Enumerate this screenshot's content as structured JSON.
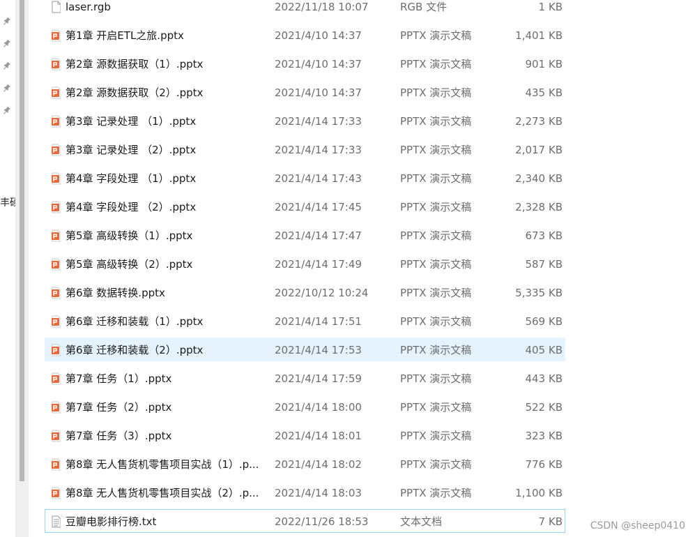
{
  "nav_pane": {
    "visible_text": "丰硕"
  },
  "files": [
    {
      "name": "laser.rgb",
      "date": "2022/11/18 10:07",
      "type": "RGB 文件",
      "size": "1 KB",
      "icon": "generic-file-icon"
    },
    {
      "name": "第1章 开启ETL之旅.pptx",
      "date": "2021/4/10 14:37",
      "type": "PPTX 演示文稿",
      "size": "1,401 KB",
      "icon": "pptx-file-icon"
    },
    {
      "name": "第2章 源数据获取（1）.pptx",
      "date": "2021/4/10 14:37",
      "type": "PPTX 演示文稿",
      "size": "901 KB",
      "icon": "pptx-file-icon"
    },
    {
      "name": "第2章 源数据获取（2）.pptx",
      "date": "2021/4/10 14:37",
      "type": "PPTX 演示文稿",
      "size": "435 KB",
      "icon": "pptx-file-icon"
    },
    {
      "name": "第3章 记录处理 （1）.pptx",
      "date": "2021/4/14 17:33",
      "type": "PPTX 演示文稿",
      "size": "2,273 KB",
      "icon": "pptx-file-icon"
    },
    {
      "name": "第3章 记录处理 （2）.pptx",
      "date": "2021/4/14 17:33",
      "type": "PPTX 演示文稿",
      "size": "2,017 KB",
      "icon": "pptx-file-icon"
    },
    {
      "name": "第4章 字段处理 （1）.pptx",
      "date": "2021/4/14 17:43",
      "type": "PPTX 演示文稿",
      "size": "2,340 KB",
      "icon": "pptx-file-icon"
    },
    {
      "name": "第4章 字段处理 （2）.pptx",
      "date": "2021/4/14 17:45",
      "type": "PPTX 演示文稿",
      "size": "2,328 KB",
      "icon": "pptx-file-icon"
    },
    {
      "name": "第5章 高级转换（1）.pptx",
      "date": "2021/4/14 17:47",
      "type": "PPTX 演示文稿",
      "size": "673 KB",
      "icon": "pptx-file-icon"
    },
    {
      "name": "第5章 高级转换（2）.pptx",
      "date": "2021/4/14 17:49",
      "type": "PPTX 演示文稿",
      "size": "587 KB",
      "icon": "pptx-file-icon"
    },
    {
      "name": "第6章 数据转换.pptx",
      "date": "2022/10/12 10:24",
      "type": "PPTX 演示文稿",
      "size": "5,335 KB",
      "icon": "pptx-file-icon"
    },
    {
      "name": "第6章 迁移和装载（1）.pptx",
      "date": "2021/4/14 17:51",
      "type": "PPTX 演示文稿",
      "size": "569 KB",
      "icon": "pptx-file-icon"
    },
    {
      "name": "第6章 迁移和装载（2）.pptx",
      "date": "2021/4/14 17:53",
      "type": "PPTX 演示文稿",
      "size": "405 KB",
      "icon": "pptx-file-icon",
      "selected": true
    },
    {
      "name": "第7章 任务（1）.pptx",
      "date": "2021/4/14 17:59",
      "type": "PPTX 演示文稿",
      "size": "443 KB",
      "icon": "pptx-file-icon"
    },
    {
      "name": "第7章 任务（2）.pptx",
      "date": "2021/4/14 18:00",
      "type": "PPTX 演示文稿",
      "size": "522 KB",
      "icon": "pptx-file-icon"
    },
    {
      "name": "第7章 任务（3）.pptx",
      "date": "2021/4/14 18:01",
      "type": "PPTX 演示文稿",
      "size": "323 KB",
      "icon": "pptx-file-icon"
    },
    {
      "name": "第8章 无人售货机零售项目实战（1）.p...",
      "date": "2021/4/14 18:02",
      "type": "PPTX 演示文稿",
      "size": "776 KB",
      "icon": "pptx-file-icon"
    },
    {
      "name": "第8章 无人售货机零售项目实战（2）.p...",
      "date": "2021/4/14 18:03",
      "type": "PPTX 演示文稿",
      "size": "1,100 KB",
      "icon": "pptx-file-icon"
    },
    {
      "name": "豆瓣电影排行榜.txt",
      "date": "2022/11/26 18:53",
      "type": "文本文档",
      "size": "7 KB",
      "icon": "text-file-icon",
      "focused": true
    }
  ],
  "watermark": "CSDN @sheep0410",
  "colors": {
    "pptx_icon": "#e8683a",
    "selection_bg": "#e5f3ff",
    "focus_border": "#99d1ff",
    "secondary_text": "#6d6d6d"
  }
}
